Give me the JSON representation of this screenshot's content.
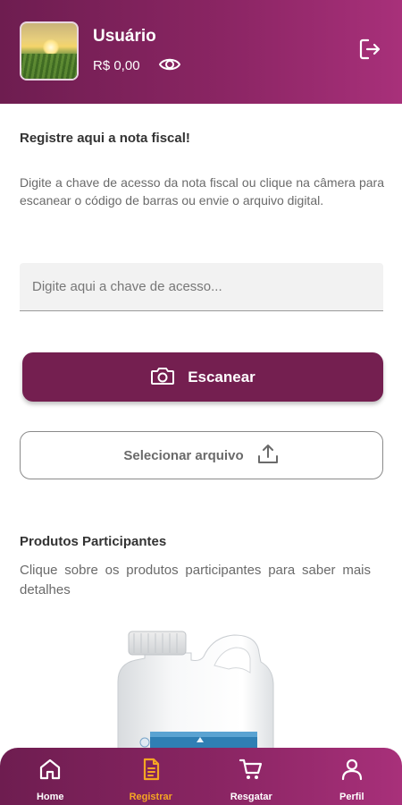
{
  "header": {
    "username": "Usuário",
    "balance": "R$ 0,00",
    "eye_icon": "eye-icon",
    "logout_icon": "logout-icon"
  },
  "register": {
    "title": "Registre aqui a nota fiscal!",
    "description": "Digite a chave de acesso da nota fiscal ou clique na câmera para escanear o código de barras ou envie o arquivo digital.",
    "input_placeholder": "Digite aqui a chave de acesso...",
    "input_value": "",
    "scan_label": "Escanear",
    "file_label": "Selecionar arquivo"
  },
  "products": {
    "title": "Produtos Participantes",
    "description": "Clique sobre os produtos participantes para saber mais detalhes"
  },
  "bottom_nav": {
    "items": [
      {
        "label": "Home",
        "icon": "home-icon"
      },
      {
        "label": "Registrar",
        "icon": "document-icon",
        "active": true
      },
      {
        "label": "Resgatar",
        "icon": "cart-icon"
      },
      {
        "label": "Perfil",
        "icon": "user-icon"
      }
    ]
  },
  "colors": {
    "brand": "#741f50",
    "header_gradient_end": "#a8307a",
    "active_nav": "#f5a623"
  }
}
